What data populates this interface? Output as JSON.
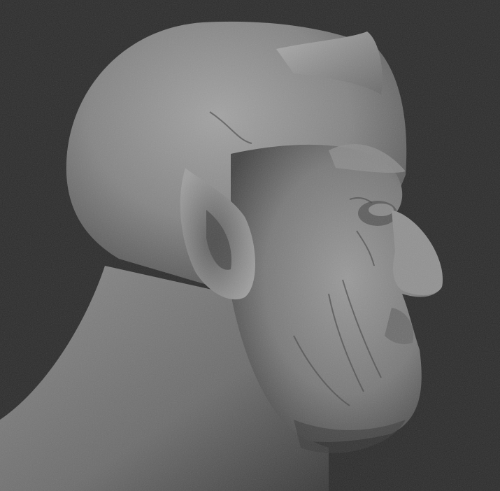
{
  "scene": {
    "background_color": "#2c2c2c",
    "material_color": "#8c8c8c",
    "subject_icon": "sculpted-head-profile-icon",
    "features": [
      "horns",
      "pointed-ear",
      "skin-texture",
      "hooked-nose"
    ]
  }
}
